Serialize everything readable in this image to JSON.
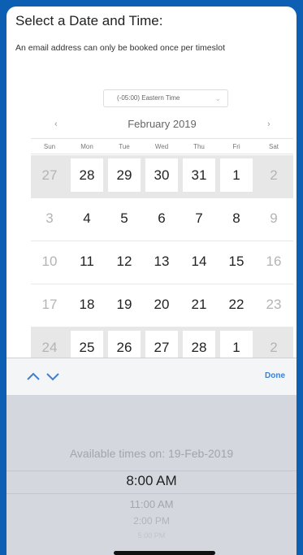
{
  "header": {
    "title": "Select a Date and Time:",
    "subtitle": "An email address can only be booked once per timeslot"
  },
  "calendar": {
    "timezone": "(-05:00) Eastern Time",
    "month": "February 2019",
    "prev": "‹",
    "next": "›",
    "days_of_week": [
      "Sun",
      "Mon",
      "Tue",
      "Wed",
      "Thu",
      "Fri",
      "Sat"
    ],
    "weeks": [
      {
        "days": [
          {
            "label": "27",
            "available": false
          },
          {
            "label": "28",
            "available": true
          },
          {
            "label": "29",
            "available": true
          },
          {
            "label": "30",
            "available": true
          },
          {
            "label": "31",
            "available": true
          },
          {
            "label": "1",
            "available": true
          },
          {
            "label": "2",
            "available": false
          }
        ]
      },
      {
        "days": [
          {
            "label": "3",
            "available": false
          },
          {
            "label": "4",
            "available": true
          },
          {
            "label": "5",
            "available": true
          },
          {
            "label": "6",
            "available": true
          },
          {
            "label": "7",
            "available": true
          },
          {
            "label": "8",
            "available": true
          },
          {
            "label": "9",
            "available": false
          }
        ]
      },
      {
        "days": [
          {
            "label": "10",
            "available": false
          },
          {
            "label": "11",
            "available": true
          },
          {
            "label": "12",
            "available": true
          },
          {
            "label": "13",
            "available": true
          },
          {
            "label": "14",
            "available": true
          },
          {
            "label": "15",
            "available": true
          },
          {
            "label": "16",
            "available": false
          }
        ]
      },
      {
        "days": [
          {
            "label": "17",
            "available": false
          },
          {
            "label": "18",
            "available": true
          },
          {
            "label": "19",
            "available": true
          },
          {
            "label": "20",
            "available": true
          },
          {
            "label": "21",
            "available": true
          },
          {
            "label": "22",
            "available": true
          },
          {
            "label": "23",
            "available": false
          }
        ]
      },
      {
        "days": [
          {
            "label": "24",
            "available": false
          },
          {
            "label": "25",
            "available": true
          },
          {
            "label": "26",
            "available": true
          },
          {
            "label": "27",
            "available": true
          },
          {
            "label": "28",
            "available": true
          },
          {
            "label": "1",
            "available": true
          },
          {
            "label": "2",
            "available": false
          }
        ]
      }
    ]
  },
  "toolbar": {
    "done_label": "Done",
    "prev_icon": "chevron-up-icon",
    "next_icon": "chevron-down-icon"
  },
  "picker": {
    "header": "Available times on: 19-Feb-2019",
    "selected": "8:00 AM",
    "options_below": [
      "11:00 AM",
      "2:00 PM",
      "5:00 PM"
    ]
  },
  "colors": {
    "background": "#0d5fb3",
    "accent": "#3d7fd1",
    "shaded_row": "#e7e7e7"
  }
}
